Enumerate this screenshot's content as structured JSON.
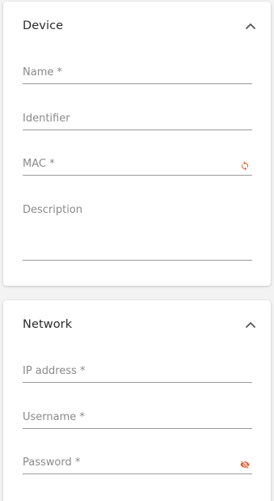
{
  "device_section": {
    "title": "Device",
    "fields": {
      "name": {
        "label": "Name *",
        "value": ""
      },
      "identifier": {
        "label": "Identifier",
        "value": ""
      },
      "mac": {
        "label": "MAC *",
        "value": ""
      },
      "description": {
        "label": "Description",
        "value": ""
      }
    }
  },
  "network_section": {
    "title": "Network",
    "fields": {
      "ip_address": {
        "label": "IP address *",
        "value": ""
      },
      "username": {
        "label": "Username *",
        "value": ""
      },
      "password": {
        "label": "Password *",
        "value": ""
      }
    }
  },
  "colors": {
    "accent": "#e8562a",
    "label": "#8a8a8a",
    "underline": "#9a9a9a",
    "card": "#ffffff",
    "background": "#f3f3f3"
  },
  "icons": {
    "collapse": "chevron-up-icon",
    "mac_generate": "refresh-icon",
    "password_visibility": "eye-off-icon"
  }
}
